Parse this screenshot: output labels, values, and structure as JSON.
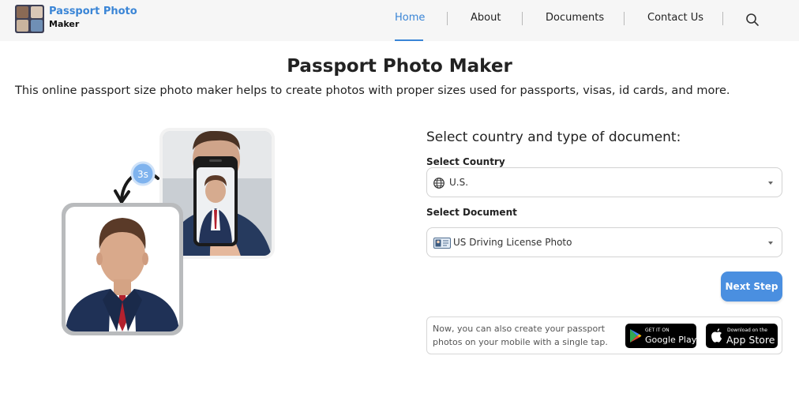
{
  "brand": {
    "name": "Passport Photo",
    "subname": "Maker"
  },
  "nav": {
    "items": [
      {
        "label": "Home",
        "active": true
      },
      {
        "label": "About",
        "active": false
      },
      {
        "label": "Documents",
        "active": false
      },
      {
        "label": "Contact Us",
        "active": false
      }
    ],
    "search_icon": "search-icon"
  },
  "page": {
    "title": "Passport Photo Maker",
    "description": "This online passport size photo maker helps to create photos with proper sizes used for passports, visas, id cards, and more."
  },
  "illustration": {
    "timer_label": "3s"
  },
  "form": {
    "heading": "Select country and type of document:",
    "country_label": "Select Country",
    "country_value": "U.S.",
    "country_icon": "globe-icon",
    "document_label": "Select Document",
    "document_value": "US Driving License Photo",
    "document_icon": "id-card-icon",
    "next_label": "Next Step"
  },
  "promo": {
    "text": "Now, you can also create your passport photos on your mobile with a single tap.",
    "google_small": "GET IT ON",
    "google_big": "Google Play",
    "apple_small": "Download on the",
    "apple_big": "App Store"
  },
  "colors": {
    "accent": "#3a85d6",
    "button": "#4a8fe0",
    "header_bg": "#f6f6f6"
  }
}
